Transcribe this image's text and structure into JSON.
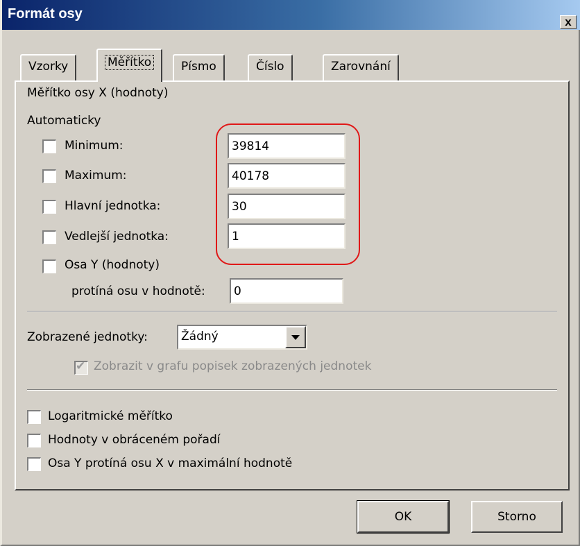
{
  "dialog": {
    "title": "Formát osy",
    "close_label": "x"
  },
  "tabs": [
    {
      "label": "Vzorky",
      "active": false
    },
    {
      "label": "Měřítko",
      "active": true
    },
    {
      "label": "Písmo",
      "active": false
    },
    {
      "label": "Číslo",
      "active": false
    },
    {
      "label": "Zarovnání",
      "active": false
    }
  ],
  "scale": {
    "section_title": "Měřítko osy X (hodnoty)",
    "auto_header": "Automaticky",
    "rows": [
      {
        "label": "Minimum:",
        "value": "39814",
        "checked": false
      },
      {
        "label": "Maximum:",
        "value": "40178",
        "checked": false
      },
      {
        "label": "Hlavní jednotka:",
        "value": "30",
        "checked": false
      },
      {
        "label": "Vedlejší jednotka:",
        "value": "1",
        "checked": false
      }
    ],
    "cross_label": "Osa Y (hodnoty)",
    "cross_checked": false,
    "cross_sublabel": "protíná osu v hodnotě:",
    "cross_value": "0"
  },
  "display_units": {
    "label": "Zobrazené jednotky:",
    "selected": "Žádný",
    "show_label_text": "Zobrazit v grafu popisek zobrazených jednotek",
    "show_label_checked": true,
    "show_label_enabled": false
  },
  "options": [
    {
      "label": "Logaritmické měřítko",
      "checked": false
    },
    {
      "label": "Hodnoty v obráceném pořadí",
      "checked": false
    },
    {
      "label": "Osa Y protíná osu X v maximální hodnotě",
      "checked": false
    }
  ],
  "buttons": {
    "ok": "OK",
    "cancel": "Storno"
  },
  "colors": {
    "title_bar": "#0a246a",
    "face": "#d4d0c8",
    "highlight": "#e01818"
  }
}
